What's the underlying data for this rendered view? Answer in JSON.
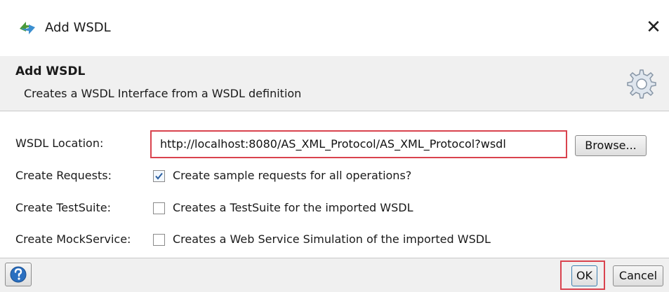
{
  "window": {
    "title": "Add WSDL",
    "close_symbol": "✕"
  },
  "header": {
    "title": "Add WSDL",
    "description": "Creates a WSDL Interface from a WSDL definition",
    "icon": "gear-icon"
  },
  "form": {
    "wsdl_location": {
      "label": "WSDL Location:",
      "value": "http://localhost:8080/AS_XML_Protocol/AS_XML_Protocol?wsdl"
    },
    "browse_label": "Browse...",
    "create_requests": {
      "label": "Create Requests:",
      "text": "Create sample requests for all operations?",
      "checked": true
    },
    "create_testsuite": {
      "label": "Create TestSuite:",
      "text": "Creates a TestSuite for the imported WSDL",
      "checked": false
    },
    "create_mockservice": {
      "label": "Create MockService:",
      "text": "Creates a Web Service Simulation of the imported WSDL",
      "checked": false
    }
  },
  "footer": {
    "ok_label": "OK",
    "cancel_label": "Cancel",
    "help_icon": "help-icon"
  },
  "colors": {
    "highlight": "#d9434e",
    "header_bg": "#f0f0f0",
    "checkmark": "#2b5fa0",
    "help_blue": "#2a6fc0"
  }
}
